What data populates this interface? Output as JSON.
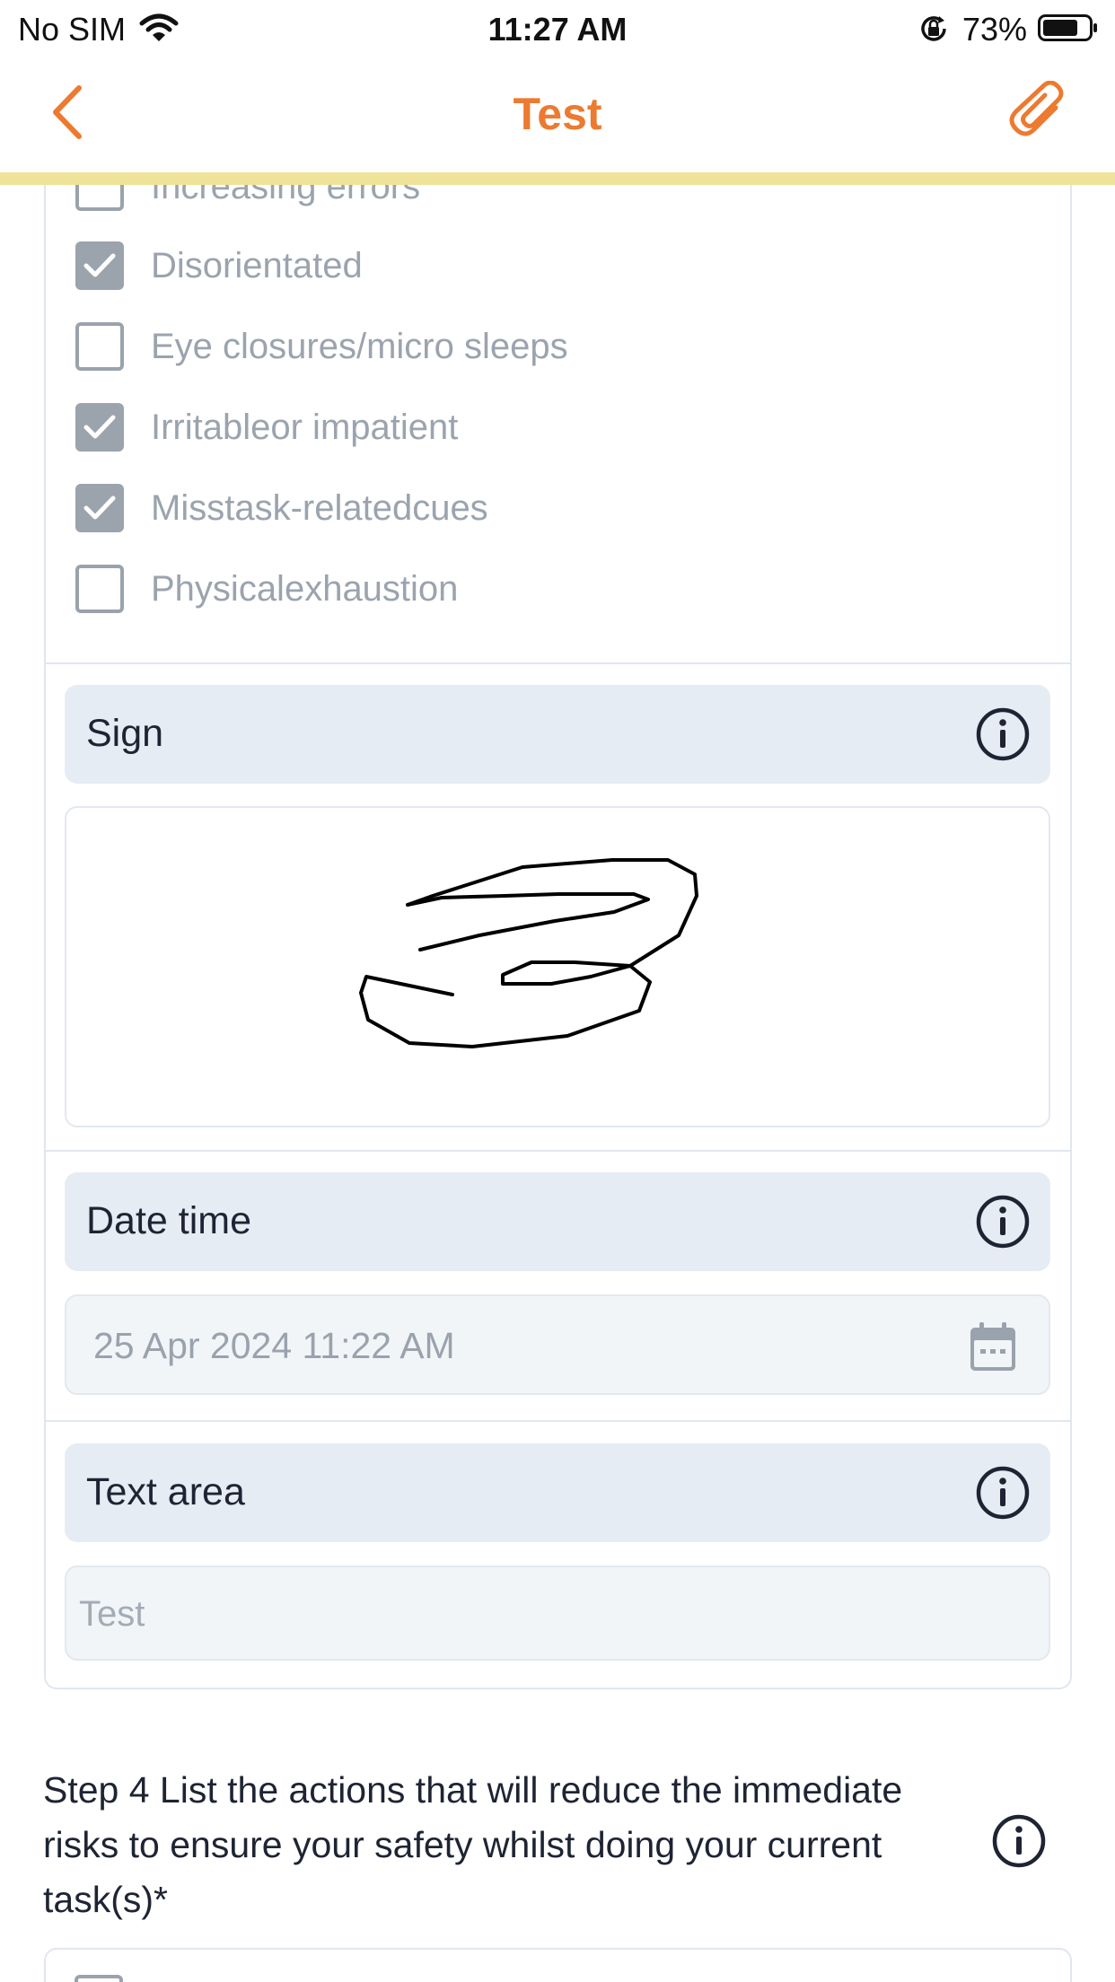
{
  "status_bar": {
    "carrier": "No SIM",
    "time": "11:27 AM",
    "battery": "73%"
  },
  "nav": {
    "title": "Test",
    "back_icon": "chevron-left-icon",
    "attach_icon": "paperclip-icon",
    "accent": "#ec7a30"
  },
  "checklist": [
    {
      "label": "Increasing errors",
      "checked": false
    },
    {
      "label": "Disorientated",
      "checked": true
    },
    {
      "label": "Eye closures/micro sleeps",
      "checked": false
    },
    {
      "label": "Irritableor impatient",
      "checked": true
    },
    {
      "label": "Misstask-relatedcues",
      "checked": true
    },
    {
      "label": "Physicalexhaustion",
      "checked": false
    }
  ],
  "sign_section": {
    "title": "Sign"
  },
  "date_section": {
    "title": "Date time",
    "value": "25 Apr 2024 11:22 AM"
  },
  "text_section": {
    "title": "Text area",
    "value": "Test"
  },
  "step4": {
    "heading": "Step 4 List the actions that will reduce the immediate risks to ensure your safety whilst doing your current task(s)*"
  }
}
